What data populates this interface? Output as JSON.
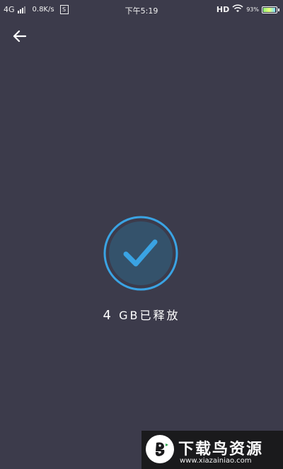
{
  "status_bar": {
    "network": "4G",
    "speed": "0.8K/s",
    "s_badge": "S",
    "time": "下午5:19",
    "hd": "HD",
    "battery_percent": "93%",
    "battery_level": 0.93
  },
  "icons": {
    "back": "back-arrow-icon",
    "check": "check-circle-icon",
    "wifi": "wifi-icon",
    "signal": "signal-bars-icon",
    "battery": "battery-icon"
  },
  "result": {
    "amount": "4",
    "unit": "GB",
    "message": "已释放"
  },
  "watermark": {
    "title": "下载鸟资源",
    "url": "www.xiazainiao.com"
  },
  "colors": {
    "background": "#3c3b4b",
    "accent": "#3aa3e3",
    "check_fill": "#34526b"
  }
}
